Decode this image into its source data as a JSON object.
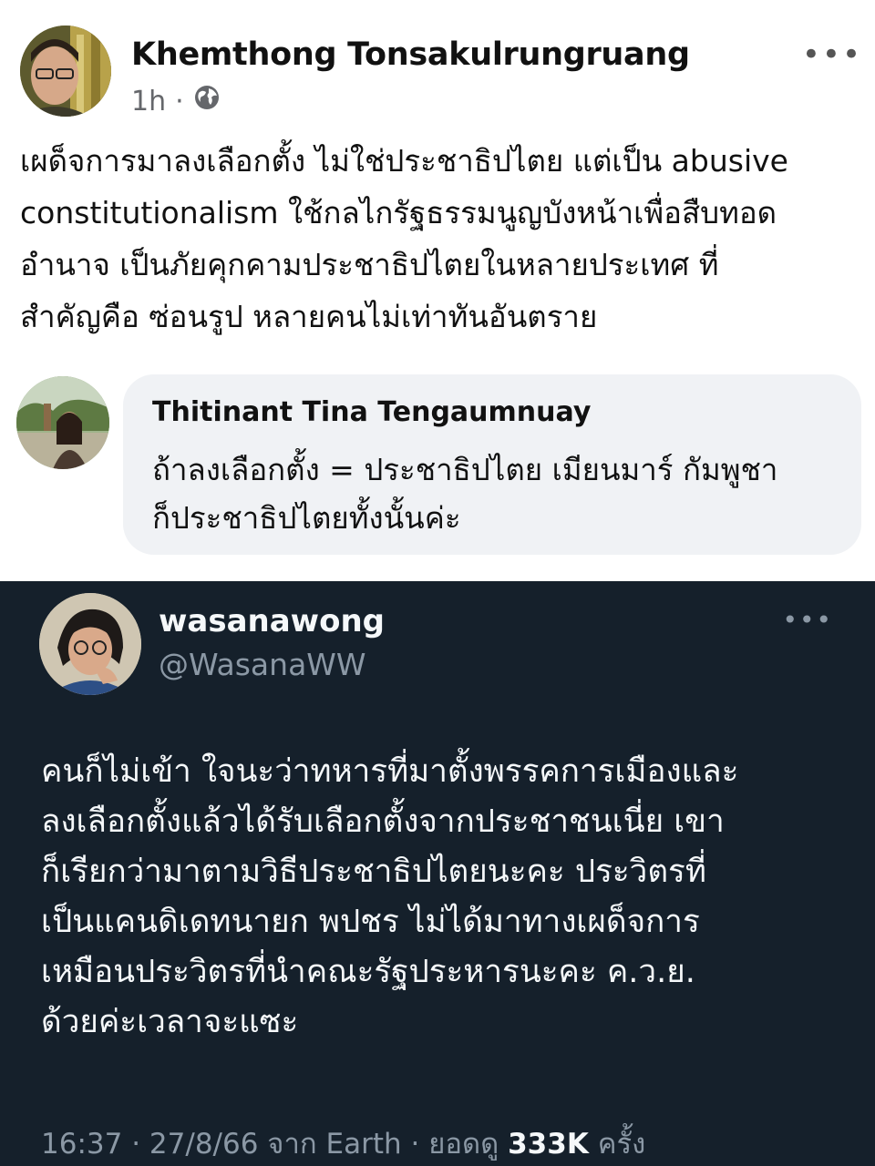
{
  "facebook_post": {
    "author": "Khemthong Tonsakulrungruang",
    "time": "1h",
    "separator": "·",
    "privacy_icon": "globe-icon",
    "more_icon": "more-horizontal-icon",
    "body_lines": [
      "เผด็จการมาลงเลือกตั้ง ไม่ใช่ประชาธิปไตย แต่เป็น abusive",
      "constitutionalism ใช้กลไกรัฐธรรมนูญบังหน้าเพื่อสืบทอด",
      "อำนาจ เป็นภัยคุกคามประชาธิปไตยในหลายประเทศ ที่",
      "สำคัญคือ ซ่อนรูป หลายคนไม่เท่าทันอันตราย"
    ],
    "comment": {
      "author": "Thitinant Tina Tengaumnuay",
      "text_lines": [
        "ถ้าลงเลือกตั้ง = ประชาธิปไตย เมียนมาร์ กัมพูชา",
        "ก็ประชาธิปไตยทั้งนั้นค่ะ"
      ]
    }
  },
  "tweet": {
    "display_name": "wasanawong",
    "handle": "@WasanaWW",
    "more_icon": "more-horizontal-icon",
    "body_lines": [
      "คนก็ไม่เข้า ใจนะว่าทหารที่มาตั้งพรรคการเมืองและ",
      "ลงเลือกตั้งแล้วได้รับเลือกตั้งจากประชาชนเนี่ย เขา",
      "ก็เรียกว่ามาตามวิธีประชาธิปไตยนะคะ ประวิตรที่",
      "เป็นแคนดิเดทนายก พปชร ไม่ได้มาทางเผด็จการ",
      "เหมือนประวิตรที่นำคณะรัฐประหารนะคะ ค.ว.ย.",
      "ด้วยค่ะเวลาจะแซะ"
    ],
    "footer": {
      "time": "16:37",
      "date": "27/8/66",
      "source": "จาก Earth",
      "views_label": "ยอดดู",
      "views_count": "333K",
      "views_suffix": "ครั้ง"
    }
  },
  "colors": {
    "tweet_background": "#15202b",
    "tweet_text": "#f5f8fa",
    "tweet_secondary": "#8b98a5",
    "comment_bubble": "#f0f2f5",
    "fb_secondary": "#65676b"
  }
}
